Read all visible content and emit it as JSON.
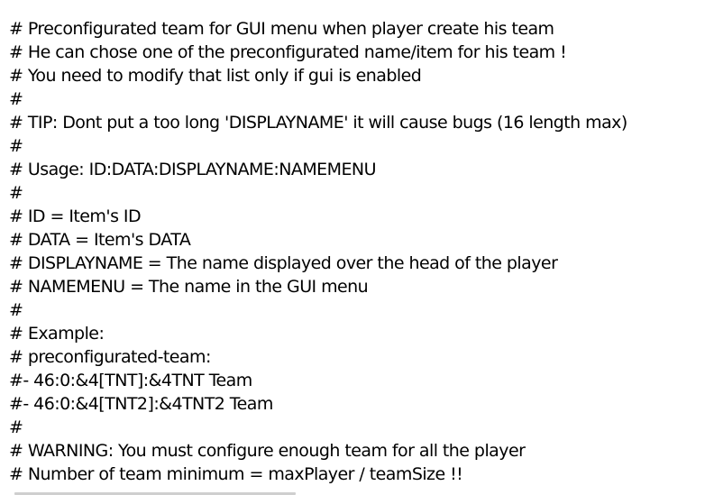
{
  "editor": {
    "lines": [
      "# Preconfigurated team for GUI menu when player create his team",
      "# He can chose one of the preconfigurated name/item for his team !",
      "# You need to modify that list only if gui is enabled",
      "#",
      "# TIP: Dont put a too long 'DISPLAYNAME' it will cause bugs (16 length max)",
      "#",
      "# Usage: ID:DATA:DISPLAYNAME:NAMEMENU",
      "#",
      "# ID = Item's ID",
      "# DATA = Item's DATA",
      "# DISPLAYNAME = The name displayed over the head of the player",
      "# NAMEMENU = The name in the GUI menu",
      "#",
      "# Example:",
      "# preconfigurated-team:",
      "#- 46:0:&4[TNT]:&4TNT Team",
      "#- 46:0:&4[TNT2]:&4TNT2 Team",
      "#",
      "# WARNING: You must configure enough team for all the player",
      "# Number of team minimum = maxPlayer / teamSize !!"
    ]
  }
}
